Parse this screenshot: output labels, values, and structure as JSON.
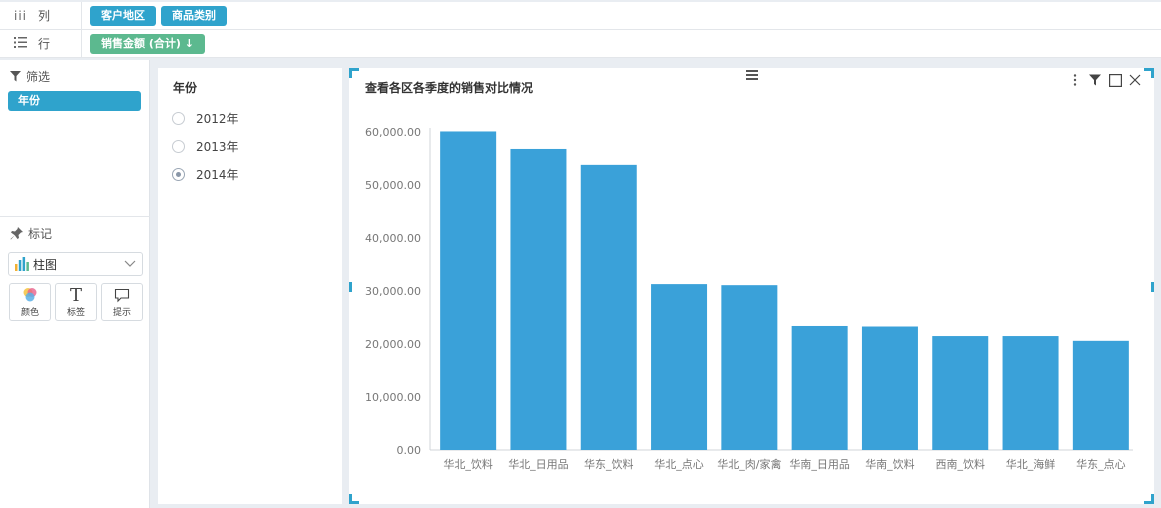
{
  "shelf": {
    "columns_label": "列",
    "rows_label": "行",
    "column_pills": [
      "客户地区",
      "商品类别"
    ],
    "row_pill": "销售金额 (合计) ↓"
  },
  "filter": {
    "title": "筛选",
    "item": "年份"
  },
  "marks": {
    "title": "标记",
    "type": "柱图",
    "buttons": [
      "颜色",
      "标签",
      "提示"
    ]
  },
  "year_filter": {
    "title": "年份",
    "options": [
      "2012年",
      "2013年",
      "2014年"
    ],
    "selected": "2014年"
  },
  "colors": {
    "accent": "#2fa3cc",
    "bar": "#3aa1d9",
    "pill_green": "#5cb98f"
  },
  "chart_data": {
    "type": "bar",
    "title": "查看各区各季度的销售对比情况",
    "categories": [
      "华北_饮料",
      "华北_日用品",
      "华东_饮料",
      "华北_点心",
      "华北_肉/家禽",
      "华南_日用品",
      "华南_饮料",
      "西南_饮料",
      "华北_海鲜",
      "华东_点心"
    ],
    "values": [
      60100,
      56800,
      53800,
      31300,
      31100,
      23400,
      23300,
      21500,
      21500,
      20600
    ],
    "yticks": [
      "0.00",
      "10,000.00",
      "20,000.00",
      "30,000.00",
      "40,000.00",
      "50,000.00",
      "60,000.00"
    ],
    "ylim": [
      0,
      60000
    ],
    "xlabel": "",
    "ylabel": "",
    "grid": false
  }
}
